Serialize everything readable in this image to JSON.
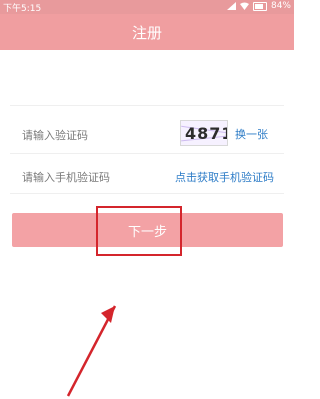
{
  "status_bar": {
    "time": "下午5:15",
    "battery": "84%",
    "icons": [
      "signal-icon",
      "wifi-icon",
      "battery-icon"
    ]
  },
  "header": {
    "title": "注册"
  },
  "form": {
    "captcha_label": "请输入验证码",
    "captcha_text": "4871",
    "refresh_captcha": "换一张",
    "phone_code_label": "请输入手机验证码",
    "get_phone_code": "点击获取手机验证码"
  },
  "buttons": {
    "next": "下一步"
  },
  "colors": {
    "header_bg": "#f09ea0",
    "button_bg": "#f3a2a5",
    "link": "#2d7cc7",
    "annotation": "#d4252c"
  }
}
